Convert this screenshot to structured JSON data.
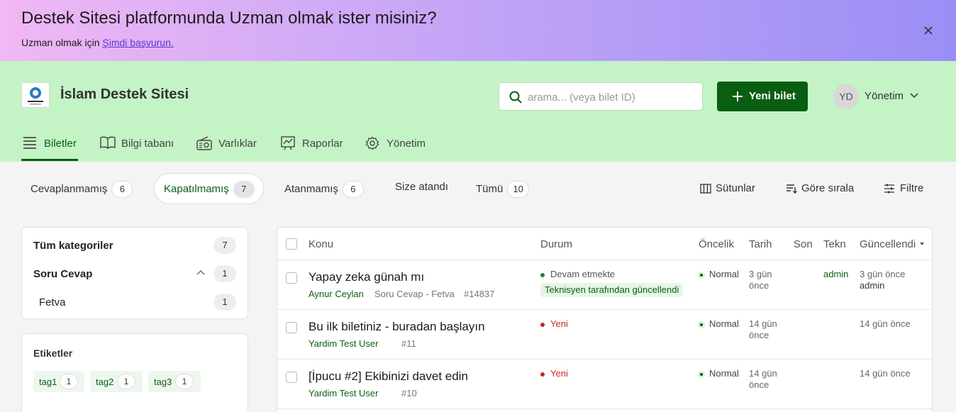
{
  "banner": {
    "title": "Destek Sitesi platformunda Uzman olmak ister misiniz?",
    "subtitle_prefix": "Uzman olmak için ",
    "subtitle_link": "Şimdi başvurun.",
    "close_icon": "close-icon"
  },
  "header": {
    "site_name": "İslam Destek Sitesi",
    "search_placeholder": "arama... (veya bilet ID)",
    "new_ticket_label": "Yeni bilet",
    "avatar_initials": "YD",
    "admin_label": "Yönetim"
  },
  "nav": {
    "items": [
      {
        "label": "Biletler",
        "icon": "list-icon",
        "active": true
      },
      {
        "label": "Bilgi tabanı",
        "icon": "book-icon"
      },
      {
        "label": "Varlıklar",
        "icon": "radio-icon"
      },
      {
        "label": "Raporlar",
        "icon": "chart-icon"
      },
      {
        "label": "Yönetim",
        "icon": "gear-icon"
      }
    ]
  },
  "filters": [
    {
      "label": "Cevaplanmamış",
      "count": "6"
    },
    {
      "label": "Kapatılmamış",
      "count": "7",
      "active": true
    },
    {
      "label": "Atanmamış",
      "count": "6"
    },
    {
      "label": "Size atandı",
      "count": ""
    },
    {
      "label": "Tümü",
      "count": "10"
    }
  ],
  "tools": {
    "columns": "Sütunlar",
    "sort": "Göre sırala",
    "filter": "Filtre"
  },
  "categories": {
    "all_label": "Tüm kategoriler",
    "all_count": "7",
    "group_label": "Soru Cevap",
    "group_count": "1",
    "sub_label": "Fetva",
    "sub_count": "1"
  },
  "tags": {
    "title": "Etiketler",
    "items": [
      {
        "name": "tag1",
        "count": "1"
      },
      {
        "name": "tag2",
        "count": "1"
      },
      {
        "name": "tag3",
        "count": "1"
      }
    ]
  },
  "table": {
    "headers": {
      "subject": "Konu",
      "status": "Durum",
      "priority": "Öncelik",
      "date": "Tarih",
      "last": "Son",
      "tech": "Tekn",
      "updated": "Güncellendi"
    },
    "rows": [
      {
        "subject": "Yapay zeka günah mı",
        "user": "Aynur Ceylan",
        "category": "Soru Cevap - Fetva",
        "id": "#14837",
        "status": "Devam etmekte",
        "status_badge": "Teknisyen tarafından güncellendi",
        "priority": "Normal",
        "date_line1": "3 gün",
        "date_line2": "önce",
        "tech": "admin",
        "updated": "3 gün önce",
        "updated_by": "admin"
      },
      {
        "subject": "Bu ilk biletiniz - buradan başlayın",
        "user": "Yardim Test User",
        "category": "",
        "id": "#11",
        "status": "Yeni",
        "priority": "Normal",
        "date_line1": "14 gün",
        "date_line2": "önce",
        "tech": "",
        "updated": "14 gün önce"
      },
      {
        "subject": "[İpucu #2] Ekibinizi davet edin",
        "user": "Yardim Test User",
        "category": "",
        "id": "#10",
        "status": "Yeni",
        "priority": "Normal",
        "date_line1": "14 gün",
        "date_line2": "önce",
        "tech": "",
        "updated": "14 gün önce"
      }
    ]
  },
  "colors": {
    "accent": "#0a5e12",
    "header_bg": "#c4f3c6",
    "status_in_progress": "#2e7d32",
    "status_new": "#c62828"
  }
}
